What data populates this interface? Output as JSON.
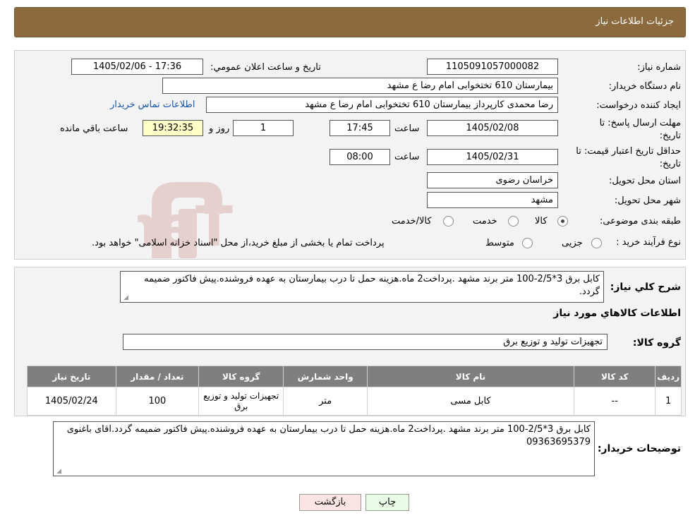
{
  "header": {
    "title": "جزئیات اطلاعات نیاز"
  },
  "fields": {
    "need_number_label": "شماره نیاز:",
    "need_number": "1105091057000082",
    "announce_label": "تاریخ و ساعت اعلان عمومي:",
    "announce_value": "1405/02/06 - 17:36",
    "buyer_org_label": "نام دستگاه خریدار:",
    "buyer_org": "بیمارستان 610 تختخوابی امام رضا ع  مشهد",
    "creator_label": "ایجاد کننده درخواست:",
    "creator": "رضا محمدی کارپرداز بیمارستان 610 تختخوابی امام رضا ع  مشهد",
    "contact_link": "اطلاعات تماس خریدار",
    "deadline_label_1": "مهلت ارسال پاسخ: تا",
    "deadline_label_2": "تاریخ:",
    "deadline_date": "1405/02/08",
    "time_label": "ساعت",
    "deadline_time": "17:45",
    "days_value": "1",
    "days_label": "روز و",
    "remaining_time": "19:32:35",
    "remaining_label": "ساعت باقي مانده",
    "validity_label_1": "حداقل تاریخ اعتبار قیمت: تا",
    "validity_label_2": "تاریخ:",
    "validity_date": "1405/02/31",
    "validity_time": "08:00",
    "province_label": "استان محل تحویل:",
    "province": "خراسان رضوی",
    "city_label": "شهر محل تحویل:",
    "city": "مشهد",
    "category_label": "طبقه بندی موضوعی:",
    "category_options": [
      "کالا",
      "خدمت",
      "کالا/خدمت"
    ],
    "process_label": "نوع فرآیند خرید :",
    "process_options": [
      "جزیی",
      "متوسط"
    ],
    "process_note": "پرداخت تمام یا بخشی از مبلغ خرید،از محل \"اسناد خزانه اسلامی\" خواهد بود."
  },
  "description": {
    "label": "شرح کلي نیاز:",
    "text": "کابل برق 3*2/5-100 متر برند مشهد .پرداخت2 ماه.هزینه حمل تا درب بیمارستان به عهده فروشنده.پیش فاکتور ضمیمه گردد."
  },
  "items_section": {
    "title": "اطلاعات کالاهاي مورد نیاز",
    "group_label": "گروه کالا:",
    "group_value": "تجهیزات تولید و توزیع برق"
  },
  "table": {
    "headers": [
      "ردیف",
      "کد کالا",
      "نام کالا",
      "واحد شمارش",
      "گروه کالا",
      "تعداد / مقدار",
      "تاریخ نیاز"
    ],
    "rows": [
      [
        "1",
        "--",
        "کابل مسی",
        "متر",
        "تجهیزات تولید و توزیع برق",
        "100",
        "1405/02/24"
      ]
    ]
  },
  "buyer_notes": {
    "label": "توضیحات خریدار:",
    "text": "کابل برق 3*2/5-100 متر برند مشهد .پرداخت2 ماه.هزینه حمل تا درب بیمارستان به عهده فروشنده.پیش فاکتور ضمیمه گردد.اقای باغنوی 09363695379"
  },
  "buttons": {
    "print": "چاپ",
    "back": "بازگشت"
  },
  "watermark_text": "AriaTender.neT",
  "colors": {
    "header_bg": "#8b6b3d",
    "panel_bg": "#f3f3f3",
    "table_header": "#7f7f7f",
    "back_btn": "#fde4e4",
    "print_btn": "#e9fbe4",
    "link": "#1a56a8"
  }
}
